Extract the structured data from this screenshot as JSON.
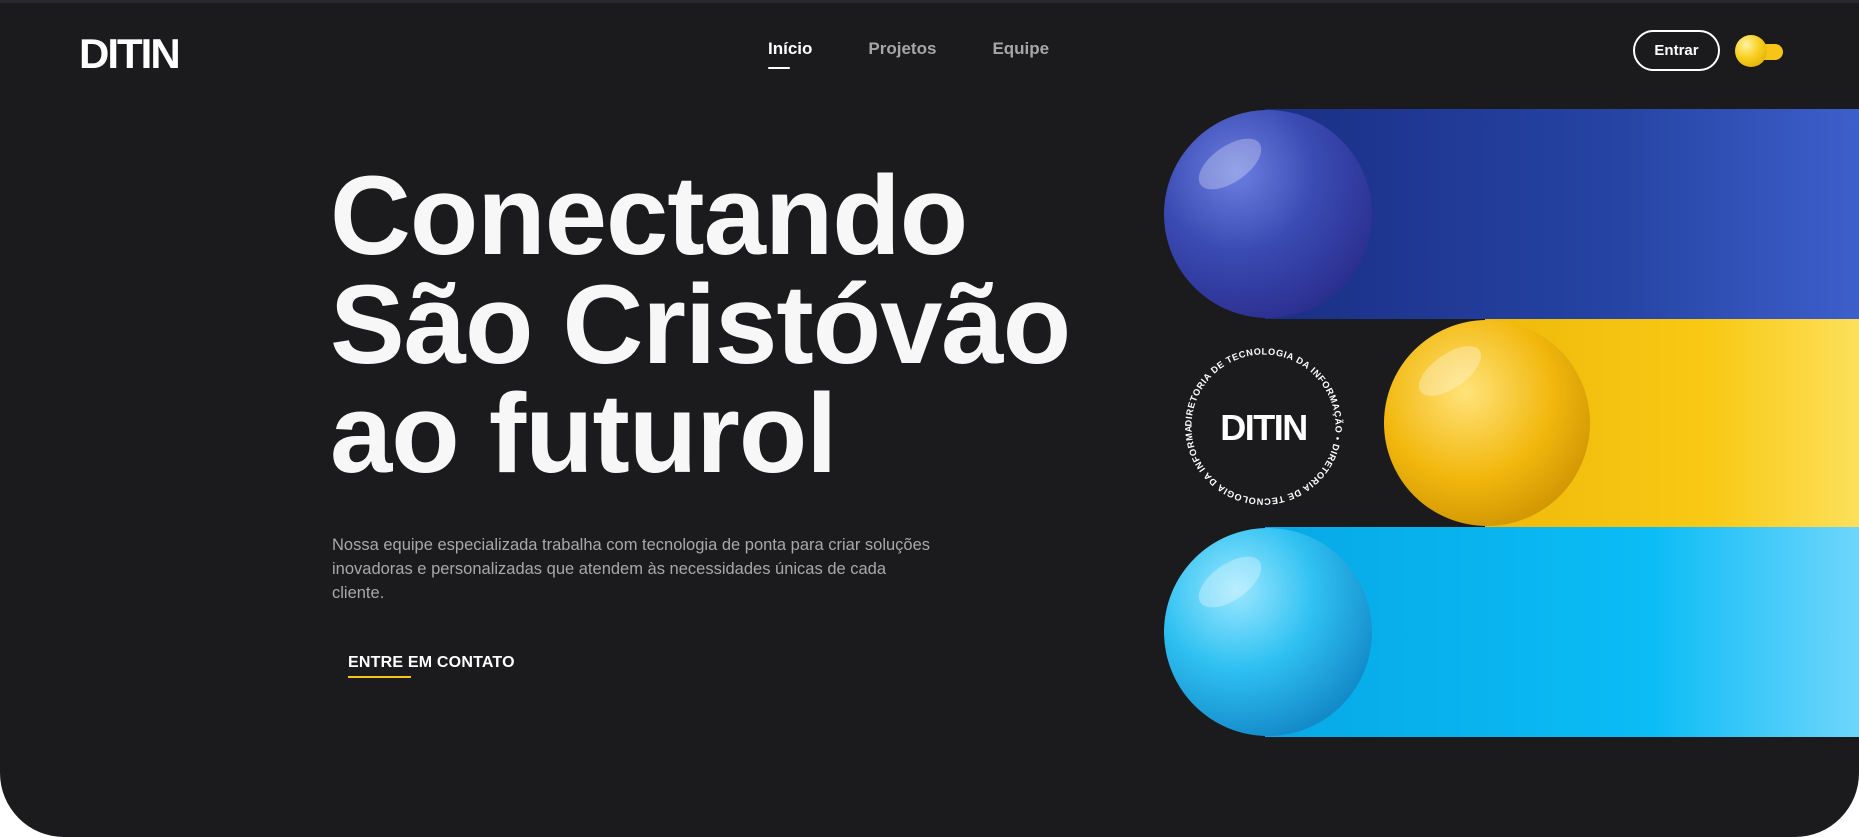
{
  "header": {
    "logo_text": "DITIN",
    "nav": [
      {
        "label": "Início",
        "active": true
      },
      {
        "label": "Projetos",
        "active": false
      },
      {
        "label": "Equipe",
        "active": false
      }
    ],
    "login_label": "Entrar",
    "theme_toggle": {
      "icon": "sun-toggle-icon",
      "accent": "#f5c518"
    }
  },
  "hero": {
    "title_lines": [
      "Conectando",
      "São Cristóvão",
      "ao futurol"
    ],
    "description": "Nossa equipe especializada trabalha com tecnologia de ponta para criar soluções inovadoras e personalizadas que atendem às necessidades únicas de cada cliente.",
    "cta_label": "ENTRE EM CONTATO"
  },
  "seal": {
    "logo_text": "DITIN",
    "ring_text": "DIRETORIA DE TECNOLOGIA DA INFORMAÇÃO • DIRETORIA DE TECNOLOGIA DA INFORMAÇÃO •"
  },
  "colors": {
    "background": "#1b1b1d",
    "blue_band": "#2a46a8",
    "yellow_band": "#f7c81b",
    "cyan_band": "#09b8f2",
    "accent": "#f5c518"
  }
}
